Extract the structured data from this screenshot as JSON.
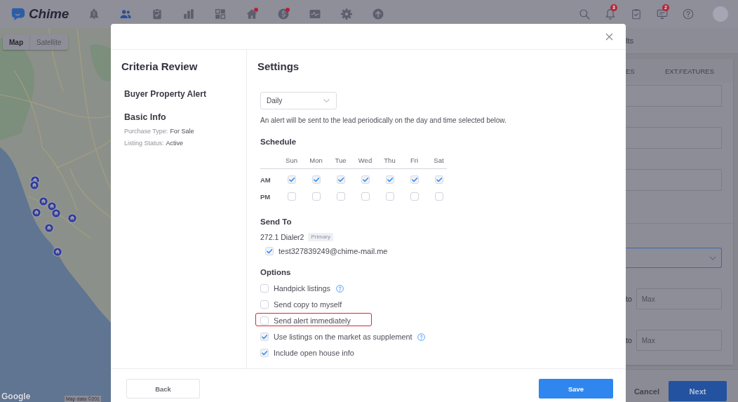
{
  "top_bar": {
    "logo": "Chime",
    "nav": [
      {
        "selected": false,
        "dot": false
      },
      {
        "selected": true,
        "dot": false
      },
      {
        "selected": false,
        "dot": false
      },
      {
        "selected": false,
        "dot": false
      },
      {
        "selected": false,
        "dot": false
      },
      {
        "selected": false,
        "dot": true
      },
      {
        "selected": false,
        "dot": true
      },
      {
        "selected": false,
        "dot": false
      },
      {
        "selected": false,
        "dot": false
      },
      {
        "selected": false,
        "dot": false
      }
    ],
    "notification_count": "3",
    "message_count": "2"
  },
  "map": {
    "type_buttons": [
      {
        "label": "Map",
        "selected": true
      },
      {
        "label": "Satellite",
        "selected": false
      }
    ],
    "logo": "Google",
    "attribution": "Map data ©201"
  },
  "form_panel": {
    "heading": "lts",
    "tabs": [
      "ES",
      "EXT.FEATURES"
    ],
    "fields": [
      {
        "kind": "input"
      },
      {
        "kind": "input"
      },
      {
        "kind": "input"
      },
      {
        "kind": "select",
        "focused": true
      }
    ],
    "ranges": [
      {
        "label": "to",
        "placeholder": "Max"
      },
      {
        "label": "to",
        "placeholder": "Max"
      }
    ],
    "cancel": "Cancel",
    "next": "Next"
  },
  "modal": {
    "sidebar": {
      "title": "Criteria Review",
      "alert_type": "Buyer Property Alert",
      "section": "Basic Info",
      "fields": [
        {
          "label": "Purchase Type:",
          "value": "For Sale"
        },
        {
          "label": "Listing Status:",
          "value": "Active"
        }
      ]
    },
    "settings": {
      "title": "Settings",
      "frequency": "Daily",
      "frequency_note": "An alert will be sent to the lead periodically on the day and time selected below.",
      "schedule": {
        "title": "Schedule",
        "days": [
          "Sun",
          "Mon",
          "Tue",
          "Wed",
          "Thu",
          "Fri",
          "Sat"
        ],
        "rows": [
          {
            "label": "AM",
            "slots": [
              {
                "checked": true
              },
              {
                "checked": true
              },
              {
                "checked": true
              },
              {
                "checked": true
              },
              {
                "checked": true
              },
              {
                "checked": true
              },
              {
                "checked": true
              }
            ]
          },
          {
            "label": "PM",
            "slots": [
              {
                "checked": false
              },
              {
                "checked": false
              },
              {
                "checked": false
              },
              {
                "checked": false
              },
              {
                "checked": false
              },
              {
                "checked": false
              },
              {
                "checked": false
              }
            ]
          }
        ]
      },
      "send_to": {
        "title": "Send To",
        "contact": "272.1 Dialer2",
        "badge": "Primary",
        "emails": [
          {
            "address": "test327839249@chime-mail.me",
            "checked": true
          }
        ]
      },
      "options": {
        "title": "Options",
        "items": [
          {
            "label": "Handpick listings",
            "checked": false,
            "help": true,
            "highlighted": false
          },
          {
            "label": "Send copy to myself",
            "checked": false,
            "help": false,
            "highlighted": false
          },
          {
            "label": "Send alert immediately",
            "checked": false,
            "help": false,
            "highlighted": true
          },
          {
            "label": "Use listings on the market as supplement",
            "checked": true,
            "help": true,
            "highlighted": false
          },
          {
            "label": "Include open house info",
            "checked": true,
            "help": false,
            "highlighted": false
          }
        ]
      }
    },
    "footer": {
      "back": "Back",
      "save": "Save"
    }
  }
}
